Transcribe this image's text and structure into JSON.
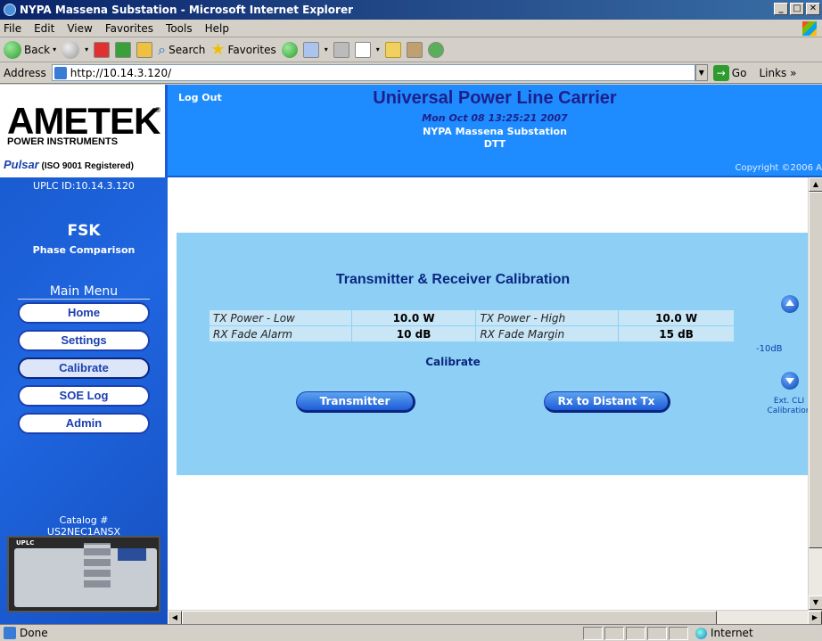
{
  "window": {
    "title": "NYPA Massena Substation - Microsoft Internet Explorer",
    "min": "_",
    "max": "□",
    "close": "✕"
  },
  "menubar": [
    "File",
    "Edit",
    "View",
    "Favorites",
    "Tools",
    "Help"
  ],
  "toolbar": {
    "back": "Back",
    "search": "Search",
    "favorites": "Favorites"
  },
  "address": {
    "label": "Address",
    "url": "http://10.14.3.120/",
    "go": "Go",
    "links": "Links »"
  },
  "logo": {
    "brand": "AMETEK",
    "reg": "®",
    "division": "POWER INSTRUMENTS",
    "pulsar": "Pulsar",
    "iso": "(ISO 9001 Registered)"
  },
  "sidebar": {
    "uplc_id": "UPLC ID:10.14.3.120",
    "mode": "FSK",
    "mode_sub": "Phase Comparison",
    "menu_header": "Main Menu",
    "items": [
      {
        "label": "Home"
      },
      {
        "label": "Settings"
      },
      {
        "label": "Calibrate"
      },
      {
        "label": "SOE Log"
      },
      {
        "label": "Admin"
      }
    ],
    "catalog_label": "Catalog #",
    "catalog_value": "US2NEC1ANSX",
    "device_label": "UPLC"
  },
  "banner": {
    "logout": "Log Out",
    "title": "Universal Power Line Carrier",
    "datetime": "Mon Oct 08 13:25:21 2007",
    "station": "NYPA Massena Substation",
    "scheme": "DTT",
    "copyright": "Copyright ©2006 A"
  },
  "calibration": {
    "title": "Transmitter & Receiver Calibration",
    "rows": [
      {
        "label1": "TX Power - Low",
        "value1": "10.0 W",
        "label2": "TX Power - High",
        "value2": "10.0 W"
      },
      {
        "label1": "RX Fade Alarm",
        "value1": "10 dB",
        "label2": "RX Fade Margin",
        "value2": "15 dB"
      }
    ],
    "sub_title": "Calibrate",
    "btn_transmitter": "Transmitter",
    "btn_rx": "Rx to Distant Tx",
    "db_value": "-10dB",
    "ext_cli": "Ext. CLI Calibration"
  },
  "statusbar": {
    "status": "Done",
    "zone": "Internet"
  },
  "colors": {
    "banner_bg": "#1e8cff",
    "sidebar_bg": "#1e5bd8",
    "panel_bg": "#8ed0f5",
    "title_text": "#0a2680"
  }
}
